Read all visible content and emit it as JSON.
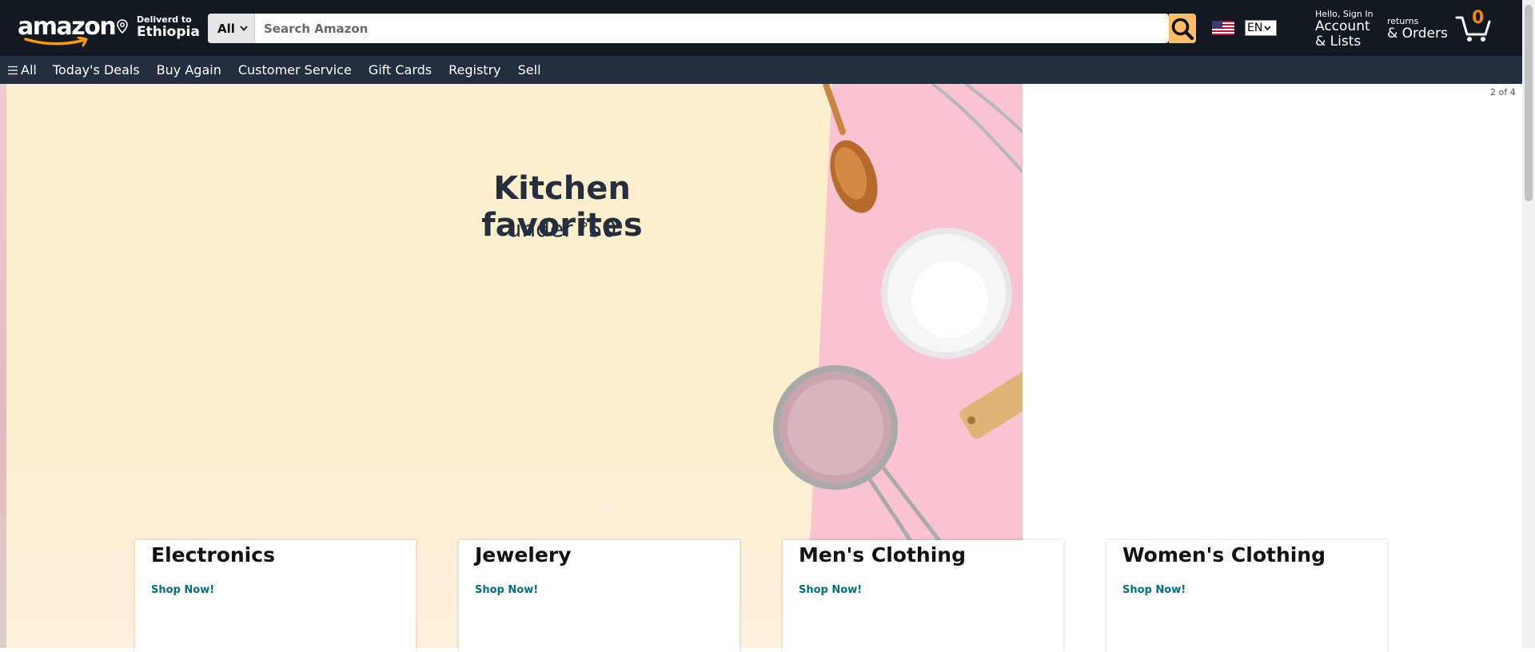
{
  "header": {
    "logo_text": "amazon",
    "deliver_label": "Deliverd to",
    "deliver_location": "Ethiopia",
    "search_category": "All",
    "search_placeholder": "Search Amazon",
    "language": "EN",
    "account_greeting": "Hello, Sign In",
    "account_line1": "Account",
    "account_line2": "& Lists",
    "returns_label": "returns",
    "orders_label": "& Orders",
    "cart_count": "0",
    "accent_color": "#febd69"
  },
  "subnav": {
    "all_label": "All",
    "items": [
      "Today's Deals",
      "Buy Again",
      "Customer Service",
      "Gift Cards",
      "Registry",
      "Sell"
    ]
  },
  "hero": {
    "title": "Kitchen favorites",
    "sub_prefix": "under ",
    "sub_currency": "$",
    "sub_amount": "50",
    "pager": "2 of 4"
  },
  "categories": [
    {
      "title": "Electronics",
      "link": "Shop Now!"
    },
    {
      "title": "Jewelery",
      "link": "Shop Now!"
    },
    {
      "title": "Men's Clothing",
      "link": "Shop Now!"
    },
    {
      "title": "Women's Clothing",
      "link": "Shop Now!"
    }
  ]
}
